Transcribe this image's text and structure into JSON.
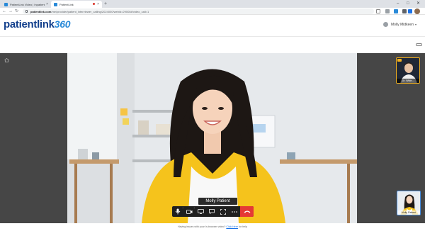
{
  "browser": {
    "tabs": [
      {
        "title": "PatientLink Video | Inpatient",
        "active": false
      },
      {
        "title": "PatientLink",
        "active": true
      }
    ],
    "new_tab_label": "+",
    "url_host": "patientlink.com",
    "url_path": "/me/provider/patient_interviewer_calling/2024000/webid=29000#/video_call=1",
    "window_controls": {
      "minimize": "–",
      "maximize": "□",
      "close": "✕"
    }
  },
  "app": {
    "logo_text": "patientlink",
    "logo_suffix": "360",
    "user_name": "Molly Midkeen",
    "user_caret": "▾"
  },
  "call": {
    "main_participant_name": "Molly Patient",
    "remote_thumbnail_label": "Dr. Wide...",
    "self_thumbnail_label": "Molly Patient",
    "toolbar_chevron": "^"
  },
  "footer": {
    "text": "Having issues with your In-browser video?",
    "link_text": "Click Here",
    "trailing": "for help"
  },
  "colors": {
    "brand_blue": "#123f8c",
    "brand_light_blue": "#2a8ad8",
    "end_call_red": "#e53935",
    "toolbar_bg": "#1f1f1f",
    "jacket_yellow": "#f5c31c"
  }
}
